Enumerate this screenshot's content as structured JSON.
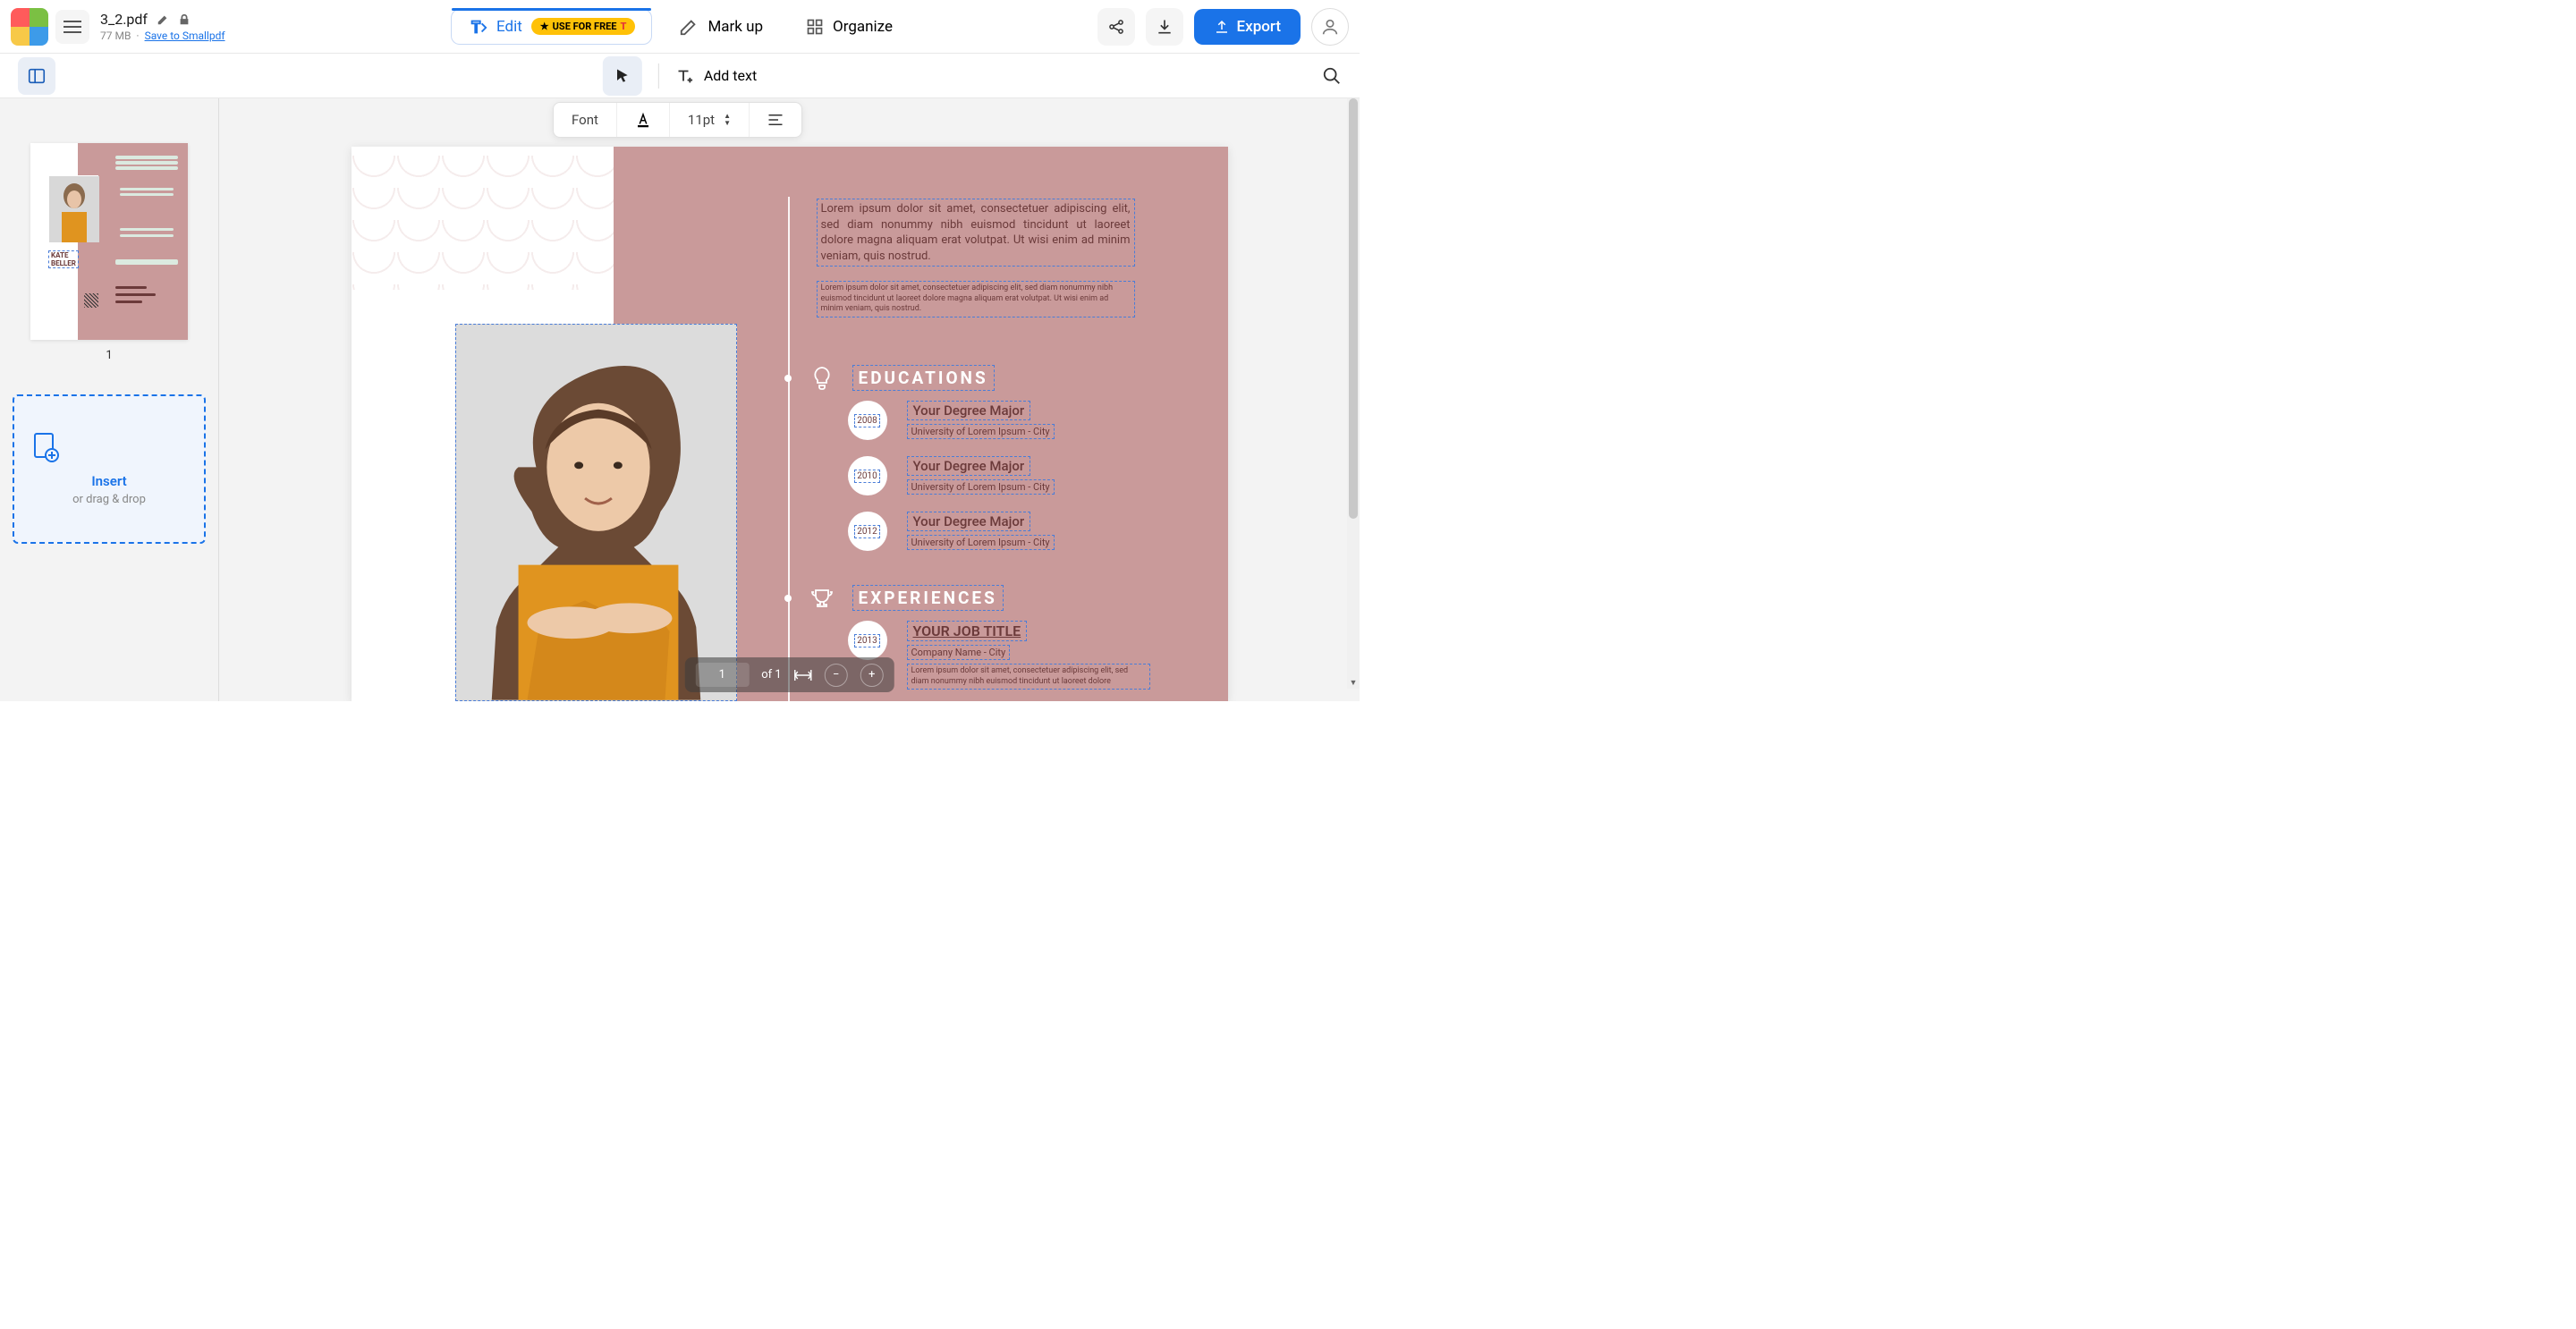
{
  "file": {
    "name": "3_2.pdf",
    "size": "77 MB",
    "save_link": "Save to Smallpdf"
  },
  "tabs": {
    "edit": "Edit",
    "edit_badge": "USE FOR FREE",
    "markup": "Mark up",
    "organize": "Organize"
  },
  "actions": {
    "export": "Export"
  },
  "subtoolbar": {
    "add_text": "Add text"
  },
  "format": {
    "font_label": "Font",
    "size": "11pt"
  },
  "sidebar": {
    "page_number": "1",
    "insert_title": "Insert",
    "insert_sub": "or drag & drop",
    "thumb_name": "KATE\nBELLER"
  },
  "doc": {
    "intro1": "Lorem ipsum dolor sit amet, consectetuer adipiscing elit, sed diam nonummy nibh euismod tincidunt ut laoreet dolore magna aliquam erat volutpat. Ut wisi enim ad minim veniam, quis nostrud.",
    "intro2": "Lorem ipsum dolor sit amet, consectetuer adipiscing elit, sed diam nonummy nibh euismod tincidunt ut laoreet dolore magna aliquam erat volutpat. Ut wisi enim ad minim veniam, quis nostrud.",
    "educations_title": "EDUCATIONS",
    "experiences_title": "EXPERIENCES",
    "edu": [
      {
        "year": "2008",
        "degree": "Your Degree Major",
        "uni": "University of Lorem Ipsum - City"
      },
      {
        "year": "2010",
        "degree": "Your Degree Major",
        "uni": "University of Lorem Ipsum - City"
      },
      {
        "year": "2012",
        "degree": "Your Degree Major",
        "uni": "University of Lorem Ipsum - City"
      }
    ],
    "exp": [
      {
        "year": "2013",
        "title": "YOUR JOB TITLE",
        "company": "Company Name - City",
        "desc": "Lorem ipsum dolor sit amet, consectetuer adipiscing elit, sed diam nonummy nibh euismod tincidunt ut laoreet dolore"
      }
    ]
  },
  "page_nav": {
    "current": "1",
    "total": "of 1"
  }
}
